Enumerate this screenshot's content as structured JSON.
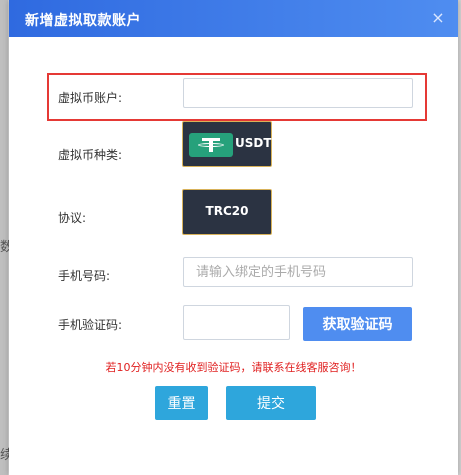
{
  "background": {
    "left_fragment_1": "数",
    "left_fragment_2": "续"
  },
  "modal": {
    "title": "新增虚拟取款账户",
    "close_symbol": "×",
    "account_label": "虚拟币账户:",
    "account_value": "",
    "coin_type_label": "虚拟币种类:",
    "coin_name": "USDT",
    "protocol_label": "协议:",
    "protocol_value": "TRC20",
    "phone_label": "手机号码:",
    "phone_placeholder": "请输入绑定的手机号码",
    "code_label": "手机验证码:",
    "code_value": "",
    "get_code_button": "获取验证码",
    "hint": "若10分钟内没有收到验证码，请联系在线客服咨询！",
    "reset_button": "重置",
    "submit_button": "提交"
  },
  "colors": {
    "header": "#3d7ae8",
    "highlight_border": "#e53935",
    "usdt_green": "#26a17b",
    "card_bg": "#2b3342",
    "card_border": "#d8b25a",
    "action_blue": "#2ea6dc",
    "hint_red": "#e02020"
  },
  "icons": {
    "coin_icon": "tether-logo-icon",
    "close_icon": "close-icon"
  }
}
